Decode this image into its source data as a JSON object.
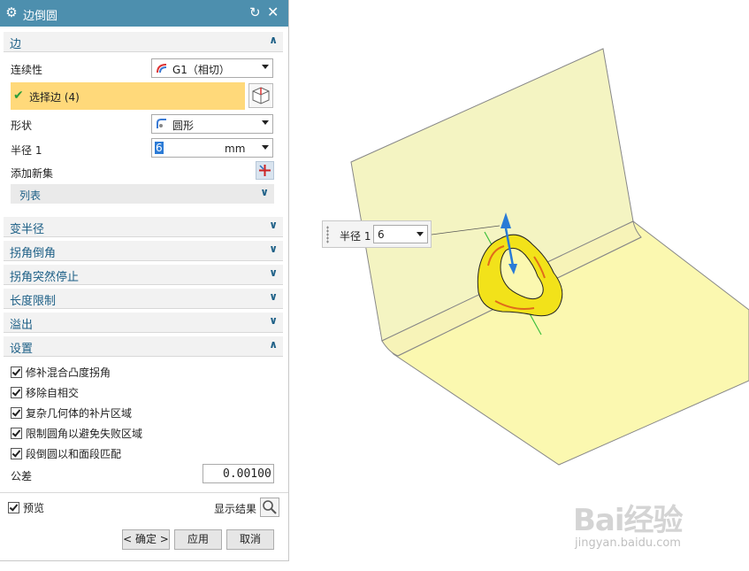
{
  "dialog": {
    "title": "边倒圆",
    "title_icon": "gear-icon",
    "edge_section": {
      "label": "边",
      "continuity_label": "连续性",
      "continuity_value": "G1（相切）",
      "select_edge_label": "选择边 (4)",
      "shape_label": "形状",
      "shape_value": "圆形",
      "radius_label": "半径 1",
      "radius_value": "6",
      "radius_unit": "mm",
      "add_new_set_label": "添加新集",
      "list_label": "列表"
    },
    "collapsed_sections": [
      "变半径",
      "拐角倒角",
      "拐角突然停止",
      "长度限制",
      "溢出"
    ],
    "settings": {
      "label": "设置",
      "checkboxes": [
        "修补混合凸度拐角",
        "移除自相交",
        "复杂几何体的补片区域",
        "限制圆角以避免失败区域",
        "段倒圆以和面段匹配"
      ],
      "tolerance_label": "公差",
      "tolerance_value": "0.00100"
    },
    "preview_label": "预览",
    "show_result_label": "显示结果",
    "buttons": {
      "ok": "< 确定 >",
      "apply": "应用",
      "cancel": "取消"
    }
  },
  "viewport": {
    "radius_label": "半径 1",
    "radius_value": "6"
  },
  "watermark": {
    "logo": "Bai经验",
    "url": "jingyan.baidu.com"
  },
  "colors": {
    "titlebar": "#4d8fae",
    "selection": "#ffd97a",
    "section_text": "#1c5f86",
    "surface": "#f4f4c2",
    "fillet": "#f2e21a"
  }
}
